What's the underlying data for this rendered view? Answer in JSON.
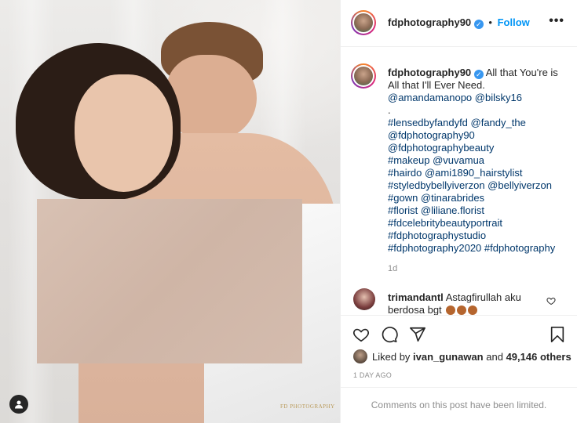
{
  "post": {
    "author": "fdphotography90",
    "follow_label": "Follow",
    "separator": "•",
    "more_label": "•••",
    "watermark": "FD PHOTOGRAPHY"
  },
  "caption": {
    "username": "fdphotography90",
    "lines": [
      "All that You're is",
      "All that I'll Ever Need.",
      "@amandamanopo @bilsky16",
      ".",
      "#lensedbyfandyfd @fandy_the",
      "@fdphotography90",
      "@fdphotographybeauty",
      "#makeup @vuvamua",
      "#hairdo @ami1890_hairstylist",
      "#styledbybellyiverzon @bellyiverzon",
      "#gown @tinarabrides",
      "#florist @liliane.florist",
      "#fdcelebritybeautyportrait",
      "#fdphotographystudio",
      "#fdphotography2020 #fdphotography"
    ],
    "age": "1d"
  },
  "comment": {
    "username": "trimandantl",
    "text": "Astagfirullah aku berdosa bgt"
  },
  "likes": {
    "prefix": "Liked by",
    "user": "ivan_gunawan",
    "and": "and",
    "count_text": "49,146 others"
  },
  "date": "1 DAY AGO",
  "comments_limited": "Comments on this post have been limited.",
  "colors": {
    "link": "#00376b",
    "follow": "#0095f6",
    "verified": "#3897f0",
    "muted": "#8e8e8e"
  },
  "icons": [
    "heart-icon",
    "comment-icon",
    "share-icon",
    "bookmark-icon",
    "user-tag-icon",
    "verified-badge-icon",
    "more-options-icon"
  ]
}
